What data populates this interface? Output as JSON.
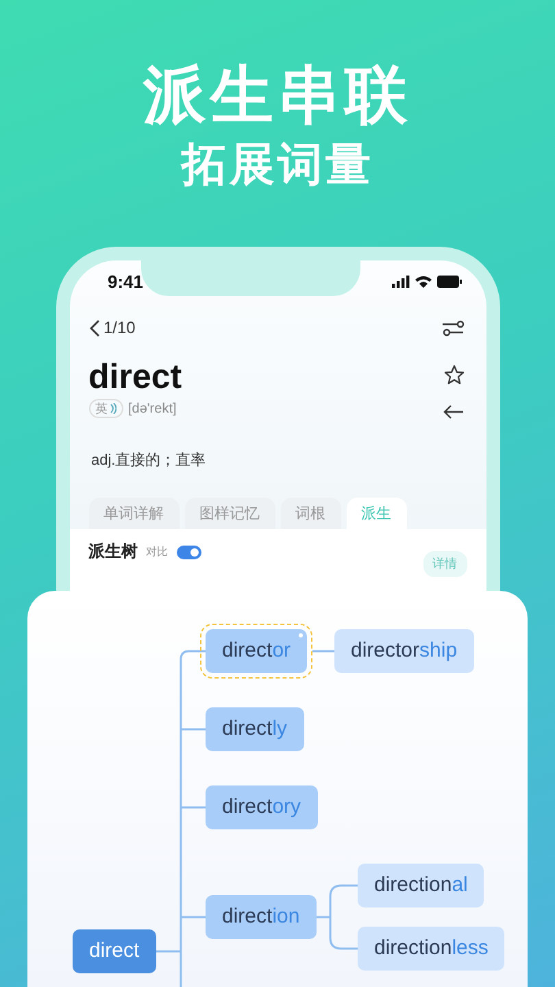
{
  "headline": {
    "title": "派生串联",
    "subtitle": "拓展词量"
  },
  "status_bar": {
    "time": "9:41"
  },
  "header": {
    "counter": "1/10"
  },
  "word": {
    "text": "direct",
    "accent": "英",
    "phonetic": "[də'rekt]",
    "definition": "adj.直接的；直率"
  },
  "tabs": [
    {
      "label": "单词详解",
      "selected": false
    },
    {
      "label": "图样记忆",
      "selected": false
    },
    {
      "label": "词根",
      "selected": false
    },
    {
      "label": "派生",
      "selected": true
    }
  ],
  "panel": {
    "title": "派生树",
    "compare_label": "对比",
    "compare_on": true,
    "detail_button": "详情"
  },
  "tree": {
    "root": {
      "stem": "direct",
      "highlighted": false,
      "children": [
        {
          "stem": "direct",
          "suffix": "or",
          "highlighted": true,
          "children": [
            {
              "stem": "director",
              "suffix": "ship",
              "highlighted": false
            }
          ]
        },
        {
          "stem": "direct",
          "suffix": "ly",
          "highlighted": false
        },
        {
          "stem": "direct",
          "suffix": "ory",
          "highlighted": false
        },
        {
          "stem": "direct",
          "suffix": "ion",
          "highlighted": false,
          "children": [
            {
              "stem": "direction",
              "suffix": "al",
              "highlighted": false
            },
            {
              "stem": "direction",
              "suffix": "less",
              "highlighted": false
            }
          ]
        }
      ]
    }
  }
}
